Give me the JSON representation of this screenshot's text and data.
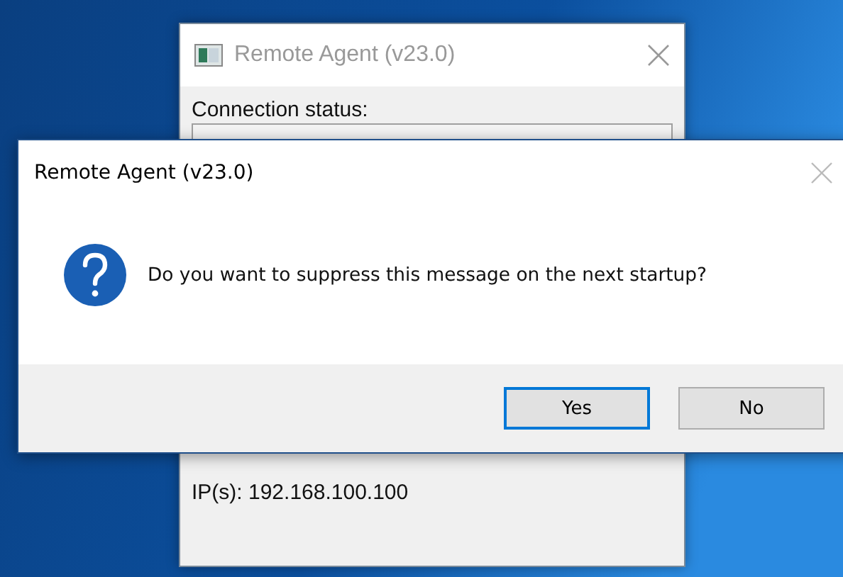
{
  "background_window": {
    "title": "Remote Agent (v23.0)",
    "connection_label": "Connection status:",
    "ip_text": "IP(s): 192.168.100.100"
  },
  "dialog": {
    "title": "Remote Agent (v23.0)",
    "message": "Do you want to suppress this message on the next startup?",
    "buttons": [
      {
        "label": "Yes",
        "selected": true
      },
      {
        "label": "No",
        "selected": false
      }
    ]
  }
}
